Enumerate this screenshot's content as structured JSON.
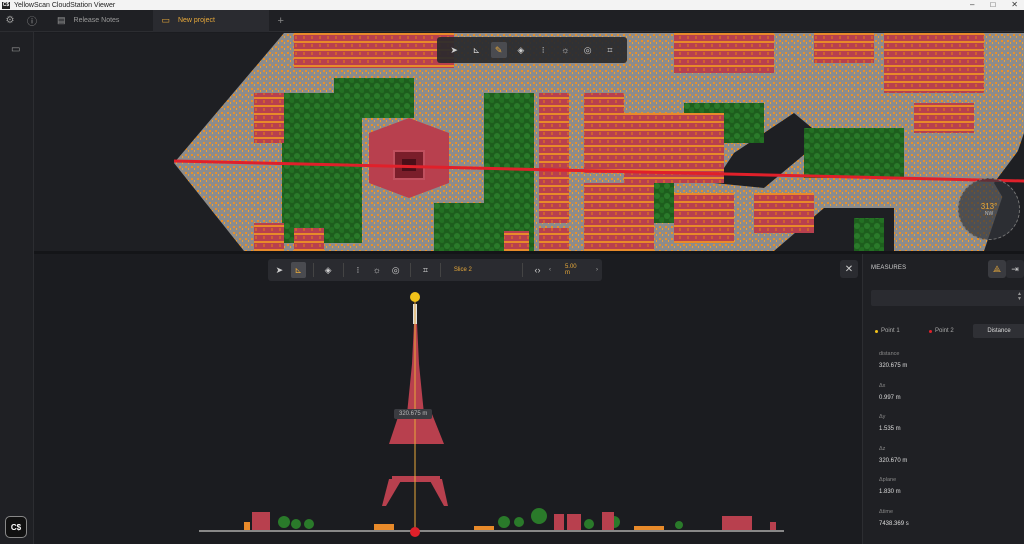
{
  "window": {
    "app_icon": "C$",
    "title": "YellowScan CloudStation Viewer",
    "controls": [
      "–",
      "□",
      "✕"
    ]
  },
  "tabs": [
    {
      "label": "Release Notes",
      "icon": "document-icon",
      "active": false
    },
    {
      "label": "New project",
      "icon": "folder-icon",
      "active": true
    }
  ],
  "add_tab": "+",
  "toolbar_top": {
    "tools": [
      "navigate-icon",
      "measure-profile-icon",
      "pen-icon",
      "paint-bucket-icon",
      "point-size-icon",
      "brightness-icon",
      "eye-filter-icon",
      "crop-icon"
    ],
    "active_index": 2
  },
  "compass": {
    "degrees": "313°",
    "direction": "NW"
  },
  "slice_toolbar": {
    "slice_name": "Slice 2",
    "width": "5.00 m",
    "decrement": "‹",
    "increment": "›"
  },
  "close_symbol": "✕",
  "distance_label": "320.675 m",
  "measures": {
    "title": "MEASURES",
    "point1": "Point 1",
    "point2": "Point 2",
    "mode": "Distance",
    "point1_color": "#f2c21a",
    "point2_color": "#e0202a",
    "rows": [
      {
        "label": "distance",
        "value": "320.675 m"
      },
      {
        "label": "Δx",
        "value": "0.997 m"
      },
      {
        "label": "Δy",
        "value": "1.535 m"
      },
      {
        "label": "Δz",
        "value": "320.670 m"
      },
      {
        "label": "Δplane",
        "value": "1.830 m"
      },
      {
        "label": "Δtime",
        "value": "7438.369 s"
      }
    ]
  },
  "colors": {
    "accent": "#e8a93a",
    "ground": "#8a8a8a",
    "vegetation": "#1f6b1f",
    "building": "#b23a4a",
    "highlight": "#f08a1a",
    "slice_line": "#e0202a"
  },
  "logo_text": "C$"
}
